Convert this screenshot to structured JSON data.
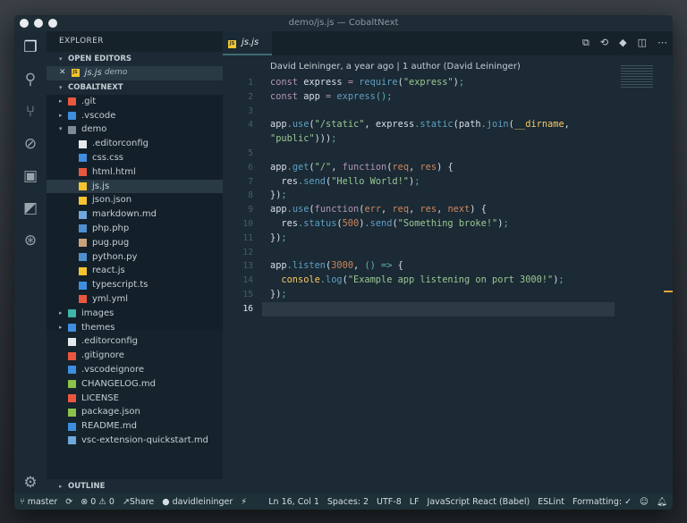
{
  "window": {
    "title": "demo/js.js — CobaltNext"
  },
  "sidebar": {
    "title": "EXPLORER",
    "open_editors": "OPEN EDITORS",
    "open_file": "js.js",
    "open_file_dir": "demo",
    "project": "COBALTNEXT",
    "outline": "OUTLINE",
    "tree": [
      {
        "label": ".git",
        "depth": 0,
        "kind": "folder",
        "icon": "git-folder-icon",
        "color": "#e9573f",
        "arrow": "▸"
      },
      {
        "label": ".vscode",
        "depth": 0,
        "kind": "folder",
        "icon": "vscode-folder-icon",
        "color": "#3e8ee0",
        "arrow": "▸"
      },
      {
        "label": "demo",
        "depth": 0,
        "kind": "folder",
        "icon": "folder-open-icon",
        "color": "#7d8b94",
        "arrow": "▾"
      },
      {
        "label": ".editorconfig",
        "depth": 1,
        "icon": "editorconfig-icon",
        "color": "#e4e9ec"
      },
      {
        "label": "css.css",
        "depth": 1,
        "icon": "css-icon",
        "color": "#3e8ee0"
      },
      {
        "label": "html.html",
        "depth": 1,
        "icon": "html-icon",
        "color": "#e9573f"
      },
      {
        "label": "js.js",
        "depth": 1,
        "icon": "js-icon",
        "color": "#f4c430",
        "selected": true
      },
      {
        "label": "json.json",
        "depth": 1,
        "icon": "json-icon",
        "color": "#f4c430"
      },
      {
        "label": "markdown.md",
        "depth": 1,
        "icon": "markdown-icon",
        "color": "#6fa8dc"
      },
      {
        "label": "php.php",
        "depth": 1,
        "icon": "php-icon",
        "color": "#4f8fd0"
      },
      {
        "label": "pug.pug",
        "depth": 1,
        "icon": "pug-icon",
        "color": "#c9a27a"
      },
      {
        "label": "python.py",
        "depth": 1,
        "icon": "python-icon",
        "color": "#4f8fd0"
      },
      {
        "label": "react.js",
        "depth": 1,
        "icon": "js-icon",
        "color": "#f4c430"
      },
      {
        "label": "typescript.ts",
        "depth": 1,
        "icon": "typescript-icon",
        "color": "#3e8ee0"
      },
      {
        "label": "yml.yml",
        "depth": 1,
        "icon": "yaml-icon",
        "color": "#e9573f"
      },
      {
        "label": "images",
        "depth": 0,
        "kind": "folder",
        "icon": "images-folder-icon",
        "color": "#3fb6a8",
        "arrow": "▸"
      },
      {
        "label": "themes",
        "depth": 0,
        "kind": "folder",
        "icon": "themes-folder-icon",
        "color": "#3e8ee0",
        "arrow": "▸"
      },
      {
        "label": ".editorconfig",
        "depth": 0,
        "icon": "editorconfig-icon",
        "color": "#e4e9ec"
      },
      {
        "label": ".gitignore",
        "depth": 0,
        "icon": "git-icon",
        "color": "#e9573f"
      },
      {
        "label": ".vscodeignore",
        "depth": 0,
        "icon": "vscode-icon",
        "color": "#3e8ee0"
      },
      {
        "label": "CHANGELOG.md",
        "depth": 0,
        "icon": "changelog-icon",
        "color": "#8bc34a"
      },
      {
        "label": "LICENSE",
        "depth": 0,
        "icon": "license-icon",
        "color": "#e9573f"
      },
      {
        "label": "package.json",
        "depth": 0,
        "icon": "npm-icon",
        "color": "#8bc34a"
      },
      {
        "label": "README.md",
        "depth": 0,
        "icon": "readme-icon",
        "color": "#3e8ee0"
      },
      {
        "label": "vsc-extension-quickstart.md",
        "depth": 0,
        "icon": "markdown-icon",
        "color": "#6fa8dc"
      }
    ]
  },
  "editor": {
    "tab": "js.js",
    "blame": "David Leininger, a year ago | 1 author (David Leininger)",
    "lines": [
      {
        "n": "1",
        "tokens": [
          [
            "k",
            "const "
          ],
          [
            "",
            "express "
          ],
          [
            "k",
            "= "
          ],
          [
            "f",
            "require"
          ],
          [
            "",
            "("
          ],
          [
            "s",
            "\"express\""
          ],
          [
            "",
            ")"
          ],
          [
            "o",
            ";"
          ]
        ]
      },
      {
        "n": "2",
        "tokens": [
          [
            "k",
            "const "
          ],
          [
            "",
            "app "
          ],
          [
            "k",
            "= "
          ],
          [
            "f",
            "express"
          ],
          [
            "o",
            "();"
          ]
        ]
      },
      {
        "n": "3",
        "tokens": []
      },
      {
        "n": "4",
        "tokens": [
          [
            "",
            "app"
          ],
          [
            "o",
            "."
          ],
          [
            "f",
            "use"
          ],
          [
            "",
            "("
          ],
          [
            "s",
            "\"/static\""
          ],
          [
            "",
            ", express"
          ],
          [
            "o",
            "."
          ],
          [
            "f",
            "static"
          ],
          [
            "",
            "(path"
          ],
          [
            "o",
            "."
          ],
          [
            "f",
            "join"
          ],
          [
            "",
            "("
          ],
          [
            "y",
            "__dirname"
          ],
          [
            "",
            ","
          ]
        ]
      },
      {
        "n": "",
        "tokens": [
          [
            "s",
            "\"public\""
          ],
          [
            "",
            ")))"
          ],
          [
            "o",
            ";"
          ]
        ]
      },
      {
        "n": "5",
        "tokens": []
      },
      {
        "n": "6",
        "tokens": [
          [
            "",
            "app"
          ],
          [
            "o",
            "."
          ],
          [
            "f",
            "get"
          ],
          [
            "",
            "("
          ],
          [
            "s",
            "\"/\""
          ],
          [
            "",
            ", "
          ],
          [
            "k",
            "function"
          ],
          [
            "",
            "("
          ],
          [
            "p",
            "req"
          ],
          [
            "",
            ", "
          ],
          [
            "p",
            "res"
          ],
          [
            "",
            ") {"
          ]
        ]
      },
      {
        "n": "7",
        "tokens": [
          [
            "",
            "  res"
          ],
          [
            "o",
            "."
          ],
          [
            "f",
            "send"
          ],
          [
            "",
            "("
          ],
          [
            "s",
            "\"Hello World!\""
          ],
          [
            "",
            ")"
          ],
          [
            "o",
            ";"
          ]
        ]
      },
      {
        "n": "8",
        "tokens": [
          [
            "",
            "})"
          ],
          [
            "o",
            ";"
          ]
        ]
      },
      {
        "n": "9",
        "tokens": [
          [
            "",
            "app"
          ],
          [
            "o",
            "."
          ],
          [
            "f",
            "use"
          ],
          [
            "",
            "("
          ],
          [
            "k",
            "function"
          ],
          [
            "",
            "("
          ],
          [
            "p",
            "err"
          ],
          [
            "",
            ", "
          ],
          [
            "p",
            "req"
          ],
          [
            "",
            ", "
          ],
          [
            "p",
            "res"
          ],
          [
            "",
            ", "
          ],
          [
            "p",
            "next"
          ],
          [
            "",
            ") {"
          ]
        ]
      },
      {
        "n": "10",
        "tokens": [
          [
            "",
            "  res"
          ],
          [
            "o",
            "."
          ],
          [
            "f",
            "status"
          ],
          [
            "",
            "("
          ],
          [
            "p",
            "500"
          ],
          [
            "",
            ")"
          ],
          [
            "o",
            "."
          ],
          [
            "f",
            "send"
          ],
          [
            "",
            "("
          ],
          [
            "s",
            "\"Something broke!\""
          ],
          [
            "",
            ")"
          ],
          [
            "o",
            ";"
          ]
        ]
      },
      {
        "n": "11",
        "tokens": [
          [
            "",
            "})"
          ],
          [
            "o",
            ";"
          ]
        ]
      },
      {
        "n": "12",
        "tokens": []
      },
      {
        "n": "13",
        "tokens": [
          [
            "",
            "app"
          ],
          [
            "o",
            "."
          ],
          [
            "f",
            "listen"
          ],
          [
            "",
            "("
          ],
          [
            "p",
            "3000"
          ],
          [
            "",
            ", "
          ],
          [
            "o",
            "() =>"
          ],
          [
            "",
            " {"
          ]
        ]
      },
      {
        "n": "14",
        "tokens": [
          [
            "y",
            "  console"
          ],
          [
            "o",
            "."
          ],
          [
            "f",
            "log"
          ],
          [
            "",
            "("
          ],
          [
            "s",
            "\"Example app listening on port 3000!\""
          ],
          [
            "",
            ")"
          ],
          [
            "o",
            ";"
          ]
        ]
      },
      {
        "n": "15",
        "tokens": [
          [
            "",
            "})"
          ],
          [
            "o",
            ";"
          ]
        ]
      },
      {
        "n": "16",
        "tokens": [],
        "current": true
      }
    ]
  },
  "status": {
    "branch": "master",
    "errors": "0",
    "warnings": "0",
    "share": "Share",
    "user": "davidleininger",
    "position": "Ln 16, Col 1",
    "spaces": "Spaces: 2",
    "encoding": "UTF-8",
    "eol": "LF",
    "language": "JavaScript React (Babel)",
    "linter": "ESLint",
    "formatting": "Formatting: ✓"
  }
}
